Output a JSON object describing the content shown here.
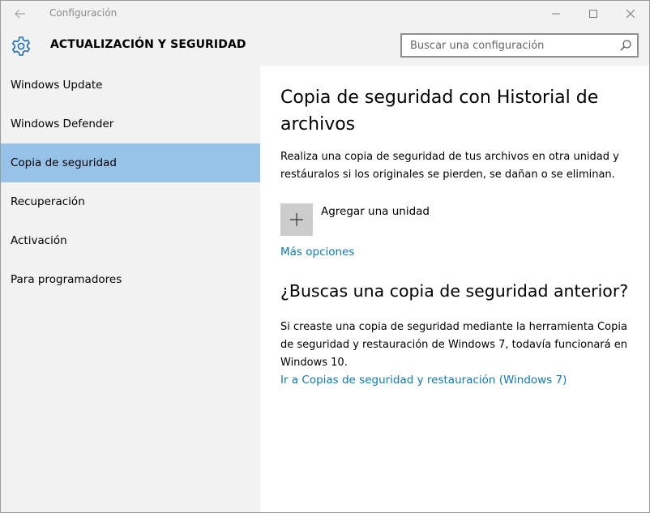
{
  "titlebar": {
    "title": "Configuración"
  },
  "header": {
    "section_title": "ACTUALIZACIÓN Y SEGURIDAD",
    "search_placeholder": "Buscar una configuración"
  },
  "sidebar": {
    "items": [
      {
        "label": "Windows Update"
      },
      {
        "label": "Windows Defender"
      },
      {
        "label": "Copia de seguridad",
        "selected": true
      },
      {
        "label": "Recuperación"
      },
      {
        "label": "Activación"
      },
      {
        "label": "Para programadores"
      }
    ]
  },
  "main": {
    "heading": "Copia de seguridad con Historial de archivos",
    "description": "Realiza una copia de seguridad de tus archivos en otra unidad y restáuralos si los originales se pierden, se dañan o se eliminan.",
    "add_drive_label": "Agregar una unidad",
    "more_options_link": "Más opciones",
    "older_backup_heading": "¿Buscas una copia de seguridad anterior?",
    "older_backup_text": "Si creaste una copia de seguridad mediante la herramienta Copia de seguridad y restauración de Windows 7, todavía funcionará en Windows 10.",
    "restore_link": "Ir a Copias de seguridad y restauración (Windows 7)"
  },
  "colors": {
    "accent": "#0f78b4",
    "selected_nav": "#96c2e8",
    "sidebar_bg": "#f2f2f2"
  },
  "icons": [
    "back-arrow-icon",
    "minimize-icon",
    "maximize-icon",
    "close-icon",
    "gear-icon",
    "search-icon",
    "plus-icon"
  ]
}
